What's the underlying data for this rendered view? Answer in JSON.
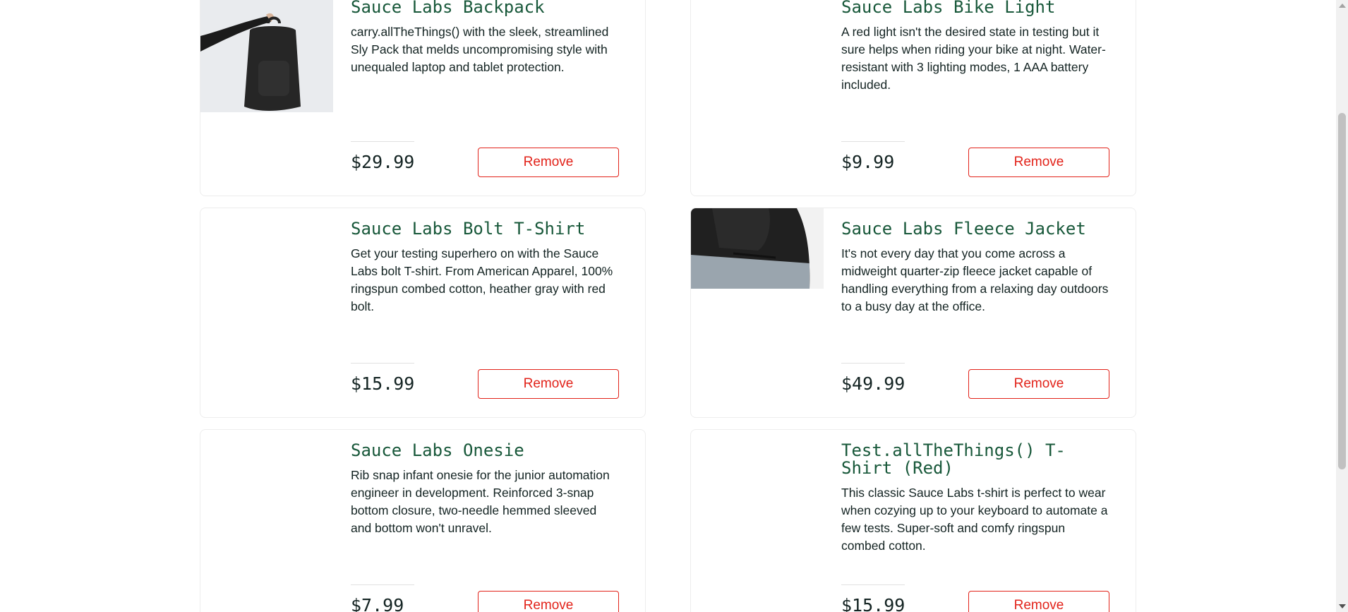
{
  "cart_items": [
    {
      "title": "Sauce Labs Backpack",
      "description": "carry.allTheThings() with the sleek, streamlined Sly Pack that melds uncompromising style with unequaled laptop and tablet protection.",
      "price": "$29.99",
      "button_label": "Remove"
    },
    {
      "title": "Sauce Labs Bike Light",
      "description": "A red light isn't the desired state in testing but it sure helps when riding your bike at night. Water-resistant with 3 lighting modes, 1 AAA battery included.",
      "price": "$9.99",
      "button_label": "Remove"
    },
    {
      "title": "Sauce Labs Bolt T-Shirt",
      "description": "Get your testing superhero on with the Sauce Labs bolt T-shirt. From American Apparel, 100% ringspun combed cotton, heather gray with red bolt.",
      "price": "$15.99",
      "button_label": "Remove"
    },
    {
      "title": "Sauce Labs Fleece Jacket",
      "description": "It's not every day that you come across a midweight quarter-zip fleece jacket capable of handling everything from a relaxing day outdoors to a busy day at the office.",
      "price": "$49.99",
      "button_label": "Remove"
    },
    {
      "title": "Sauce Labs Onesie",
      "description": "Rib snap infant onesie for the junior automation engineer in development. Reinforced 3-snap bottom closure, two-needle hemmed sleeved and bottom won't unravel.",
      "price": "$7.99",
      "button_label": "Remove"
    },
    {
      "title": "Test.allTheThings() T-Shirt (Red)",
      "description": "This classic Sauce Labs t-shirt is perfect to wear when cozying up to your keyboard to automate a few tests. Super-soft and comfy ringspun combed cotton.",
      "price": "$15.99",
      "button_label": "Remove"
    }
  ],
  "colors": {
    "title": "#18583a",
    "remove": "#e2231a",
    "text": "#132322"
  }
}
